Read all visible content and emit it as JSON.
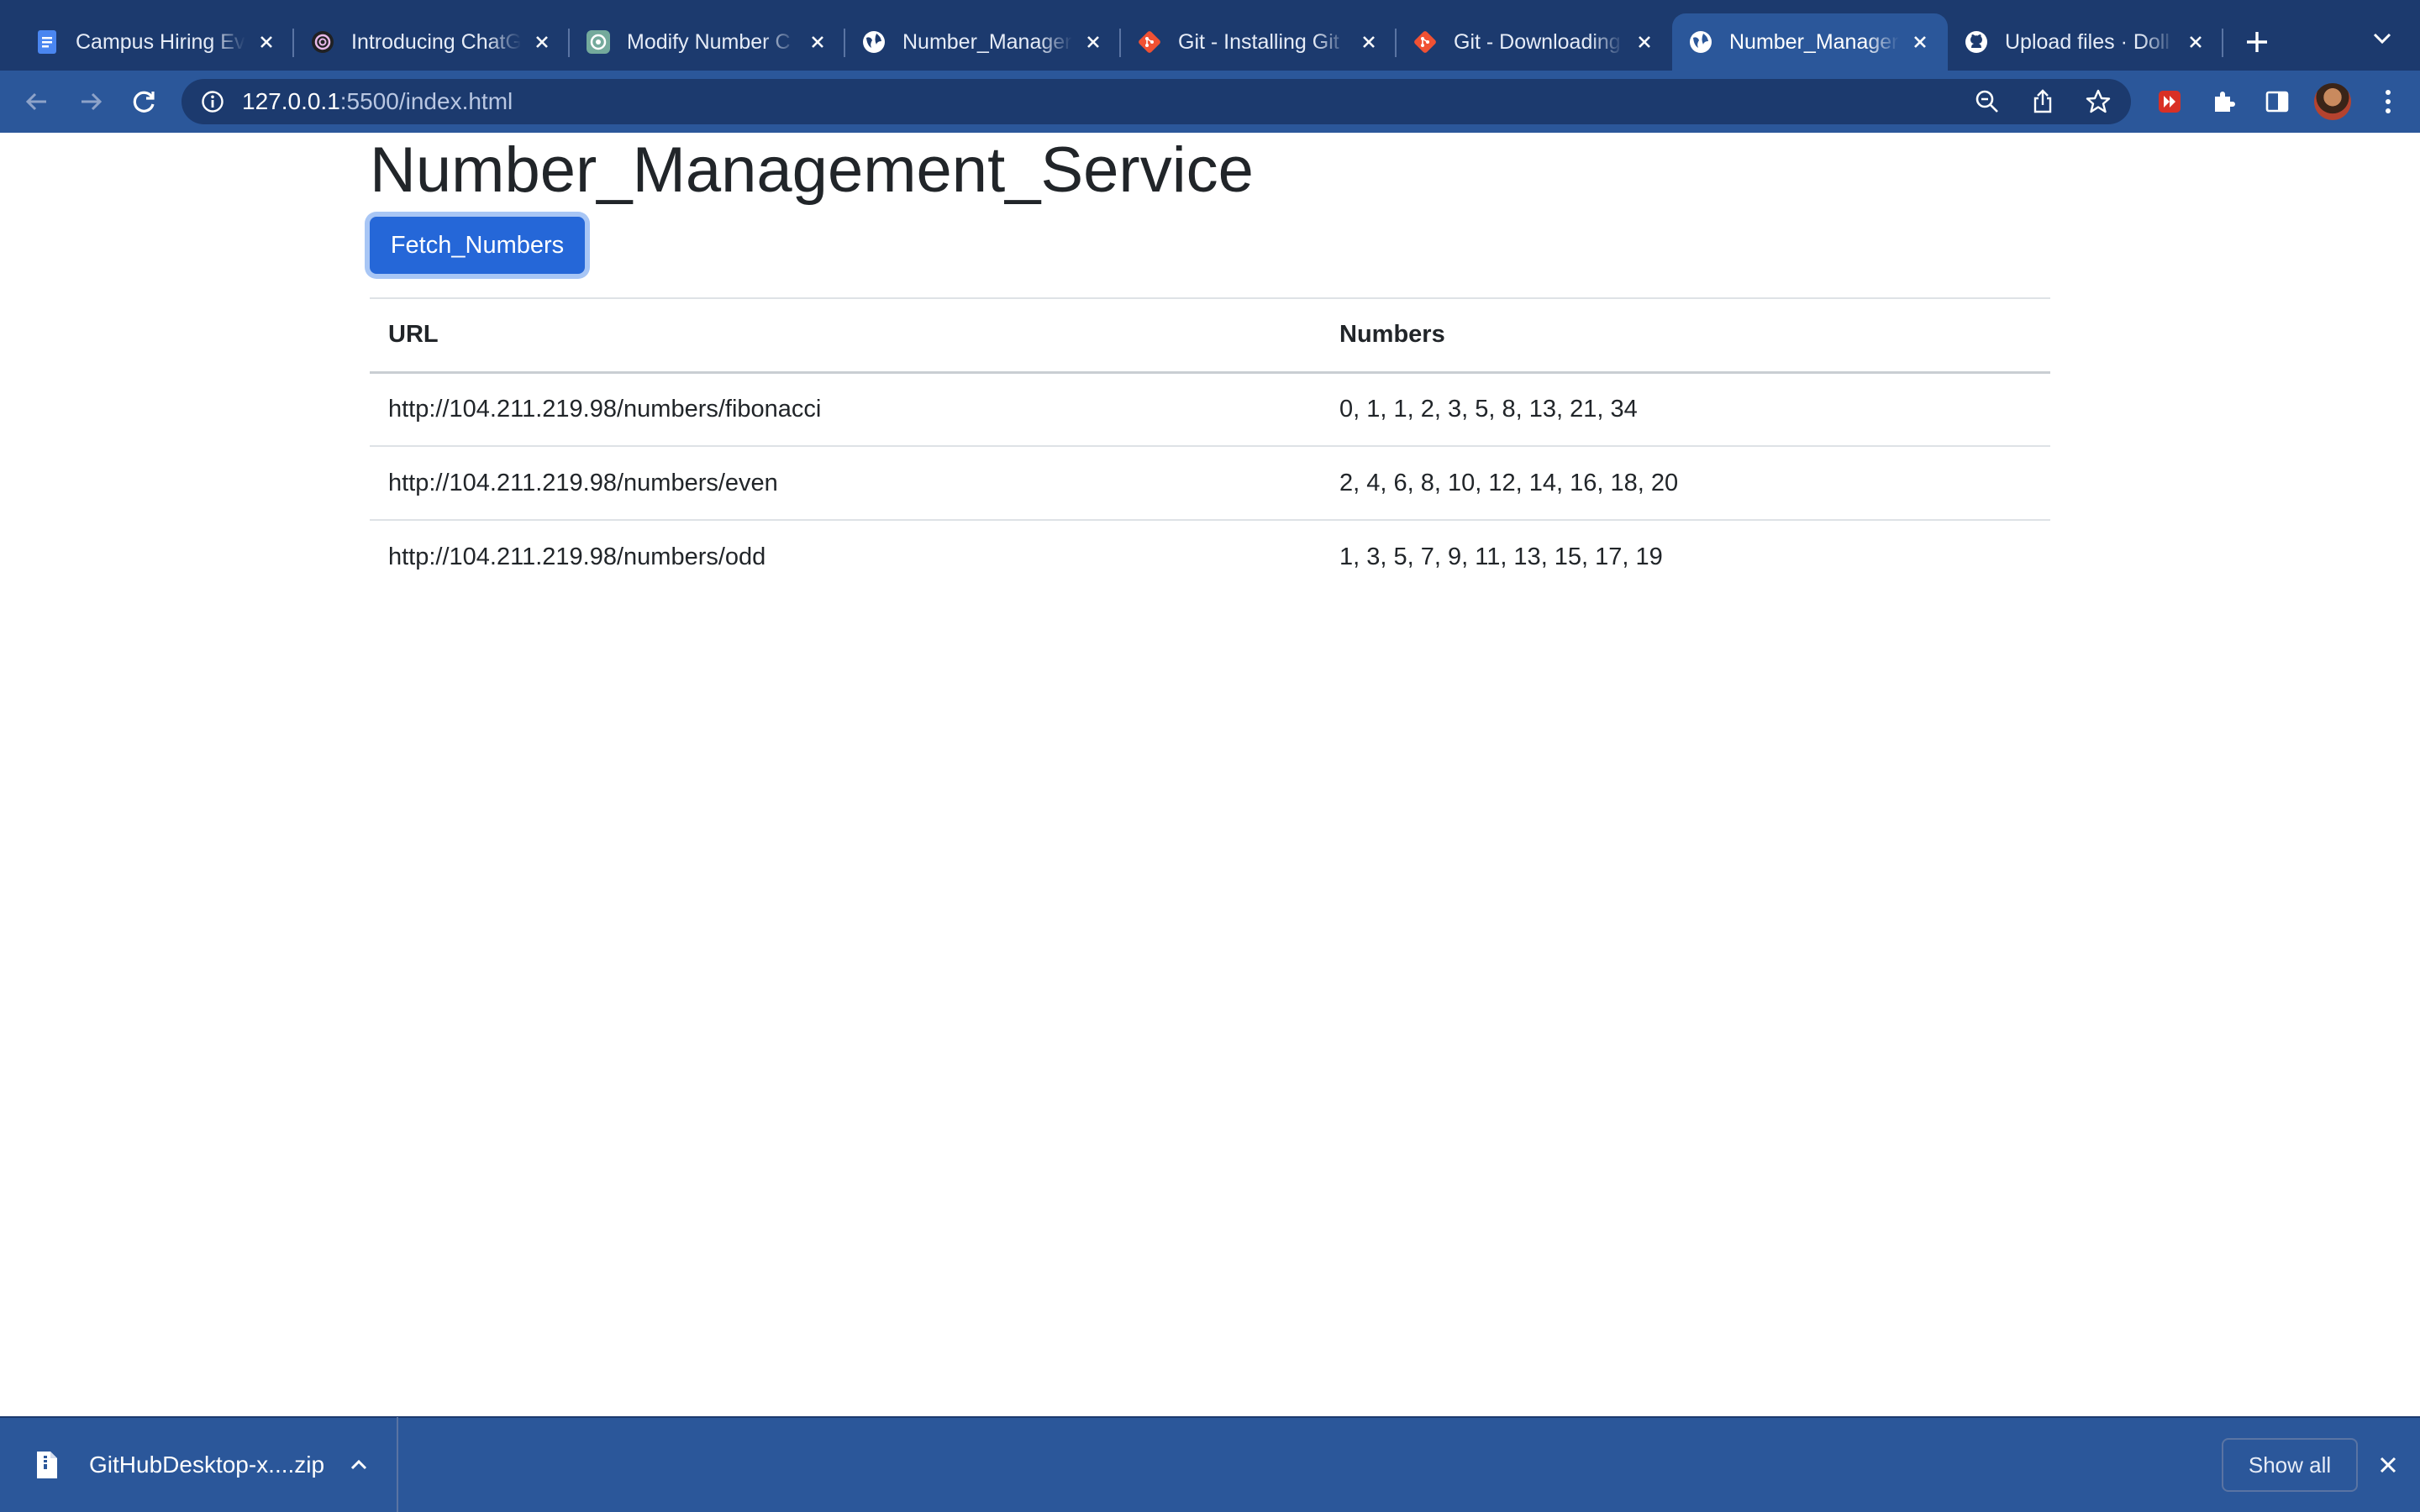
{
  "browser": {
    "tabs": [
      {
        "title": "Campus Hiring Ev",
        "icon": "docs-icon",
        "active": false
      },
      {
        "title": "Introducing ChatG",
        "icon": "openai-icon",
        "active": false
      },
      {
        "title": "Modify Number C",
        "icon": "chatgpt-icon",
        "active": false
      },
      {
        "title": "Number_Manager",
        "icon": "globe-icon",
        "active": false
      },
      {
        "title": "Git - Installing Git",
        "icon": "git-icon",
        "active": false
      },
      {
        "title": "Git - Downloading",
        "icon": "git-icon",
        "active": false
      },
      {
        "title": "Number_Manager",
        "icon": "globe-icon",
        "active": true
      },
      {
        "title": "Upload files · Doll",
        "icon": "github-icon",
        "active": false
      }
    ],
    "address": {
      "host": "127.0.0.1",
      "rest": ":5500/index.html"
    },
    "colors": {
      "frame": "#1c3a6e",
      "toolbar": "#2b579a",
      "accent_button": "#2567d8"
    }
  },
  "page": {
    "title": "Number_Management_Service",
    "fetch_button": "Fetch_Numbers",
    "table": {
      "headers": [
        "URL",
        "Numbers"
      ],
      "rows": [
        [
          "http://104.211.219.98/numbers/fibonacci",
          "0, 1, 1, 2, 3, 5, 8, 13, 21, 34"
        ],
        [
          "http://104.211.219.98/numbers/even",
          "2, 4, 6, 8, 10, 12, 14, 16, 18, 20"
        ],
        [
          "http://104.211.219.98/numbers/odd",
          "1, 3, 5, 7, 9, 11, 13, 15, 17, 19"
        ]
      ]
    }
  },
  "downloads": {
    "file_name": "GitHubDesktop-x....zip",
    "show_all": "Show all"
  }
}
